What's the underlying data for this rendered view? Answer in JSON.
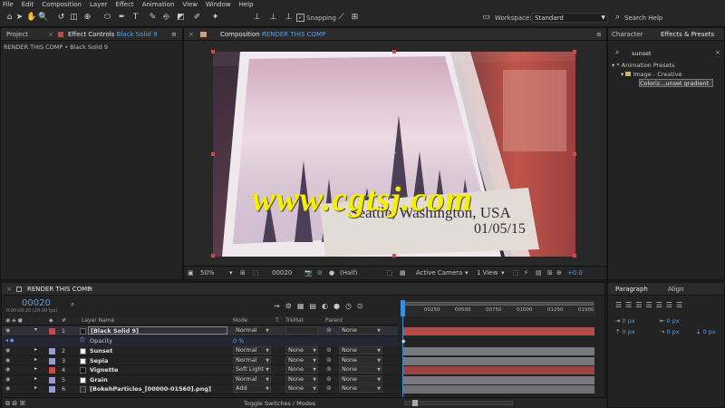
{
  "menu": [
    "File",
    "Edit",
    "Composition",
    "Layer",
    "Effect",
    "Animation",
    "View",
    "Window",
    "Help"
  ],
  "toolbar": {
    "snapping_label": "Snapping",
    "workspace_label": "Workspace:",
    "workspace_value": "Standard",
    "search_help_placeholder": "Search Help"
  },
  "project_panel": {
    "tab_project": "Project",
    "tab_effect_controls_prefix": "Effect Controls",
    "tab_effect_controls_layer": "Black Solid 9",
    "breadcrumb": "RENDER THIS COMP • Black Solid 9"
  },
  "composition_panel": {
    "tab_label": "Composition",
    "tab_comp_name": "RENDER THIS COMP"
  },
  "comp_image": {
    "photo_caption_line1": "Seattle, Washington, USA",
    "photo_caption_line2": "01/05/15",
    "watermark": "www.cgtsj.com"
  },
  "viewer_bar": {
    "zoom": "50%",
    "timecode": "00020",
    "resolution": "(Half)",
    "camera": "Active Camera",
    "views": "1 View",
    "exposure": "+0.0"
  },
  "effects_panel": {
    "tab_character": "Character",
    "tab_effects_presets": "Effects & Presets",
    "search_value": "sunset",
    "tree": [
      "* Animation Presets",
      "Image - Creative",
      "Coloriz...unset gradient"
    ]
  },
  "paragraph_panel": {
    "tab_paragraph": "Paragraph",
    "tab_align": "Align",
    "field_values": [
      "0 px",
      "0 px",
      "0 px",
      "0 px",
      "0 px"
    ]
  },
  "timeline": {
    "tab_label": "RENDER THIS COMP",
    "current_time": "00020",
    "time_sub": "0:00:00:20 (24.00 fps)",
    "ruler_ticks": [
      "00250",
      "00500",
      "00750",
      "01000",
      "01250",
      "01500"
    ],
    "columns": {
      "layer_name": "Layer Name",
      "mode": "Mode",
      "t": "T",
      "trkmat": "TrkMat",
      "parent": "Parent",
      "num": "#"
    },
    "opacity_label": "Opacity",
    "opacity_value": "0 %",
    "toggle_label": "Toggle Switches / Modes",
    "layers": [
      {
        "num": "1",
        "name": "[Black Solid 9]",
        "mode": "Normal",
        "trkmat": "",
        "parent": "None",
        "label_color": "#c44a4a",
        "swatch": "#1a1a1a",
        "bar": "#b54c4c"
      },
      {
        "num": "2",
        "name": "Sunset",
        "mode": "Normal",
        "trkmat": "None",
        "parent": "None",
        "label_color": "#9a9ad0",
        "swatch": "#ffffff",
        "bar": "#777780"
      },
      {
        "num": "3",
        "name": "Sepia",
        "mode": "Normal",
        "trkmat": "None",
        "parent": "None",
        "label_color": "#9a9ad0",
        "swatch": "#ffffff",
        "bar": "#777780"
      },
      {
        "num": "4",
        "name": "Vignette",
        "mode": "Soft Light",
        "trkmat": "None",
        "parent": "None",
        "label_color": "#c44a4a",
        "swatch": "#111111",
        "bar": "#9b4545"
      },
      {
        "num": "5",
        "name": "Grain",
        "mode": "Normal",
        "trkmat": "None",
        "parent": "None",
        "label_color": "#9a9ad0",
        "swatch": "#ffffff",
        "bar": "#777780"
      },
      {
        "num": "6",
        "name": "[BokehParticles_[00000-01560].png]",
        "mode": "Add",
        "trkmat": "None",
        "parent": "None",
        "label_color": "#9a9ad0",
        "swatch": "#2f2f2f",
        "bar": "#6f6f74"
      }
    ]
  },
  "colors": {
    "accent": "#5aa0e6",
    "playhead": "#3d8fd8",
    "selection": "#c43a3a",
    "watermark": "#f5f000"
  }
}
